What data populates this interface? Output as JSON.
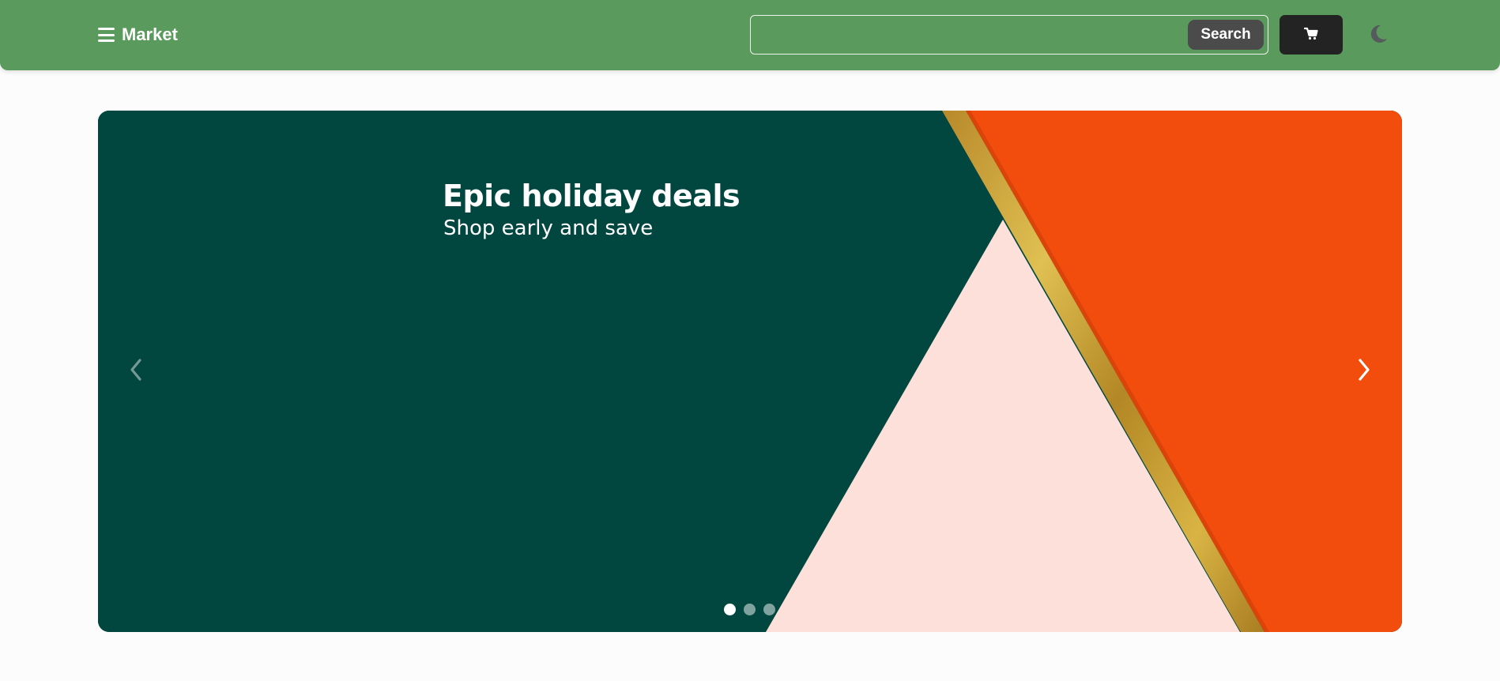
{
  "header": {
    "brand_label": "Market",
    "menu_icon": "hamburger-menu-icon",
    "search": {
      "value": "",
      "placeholder": "",
      "button_label": "Search"
    },
    "cart_icon": "shopping-cart-icon",
    "theme_icon": "moon-icon"
  },
  "hero": {
    "title": "Epic holiday deals",
    "subtitle": "Shop early and save",
    "prev_icon": "chevron-left-icon",
    "next_icon": "chevron-right-icon",
    "slide_count": 3,
    "active_slide": 1
  },
  "colors": {
    "header_bg": "#5a9a5c",
    "hero_green": "#02473f",
    "hero_orange": "#f24d0c",
    "hero_pink": "#fde0da",
    "hero_gold": "#c9a131",
    "search_button_bg": "#4b4b4b",
    "cart_button_bg": "#232323"
  }
}
